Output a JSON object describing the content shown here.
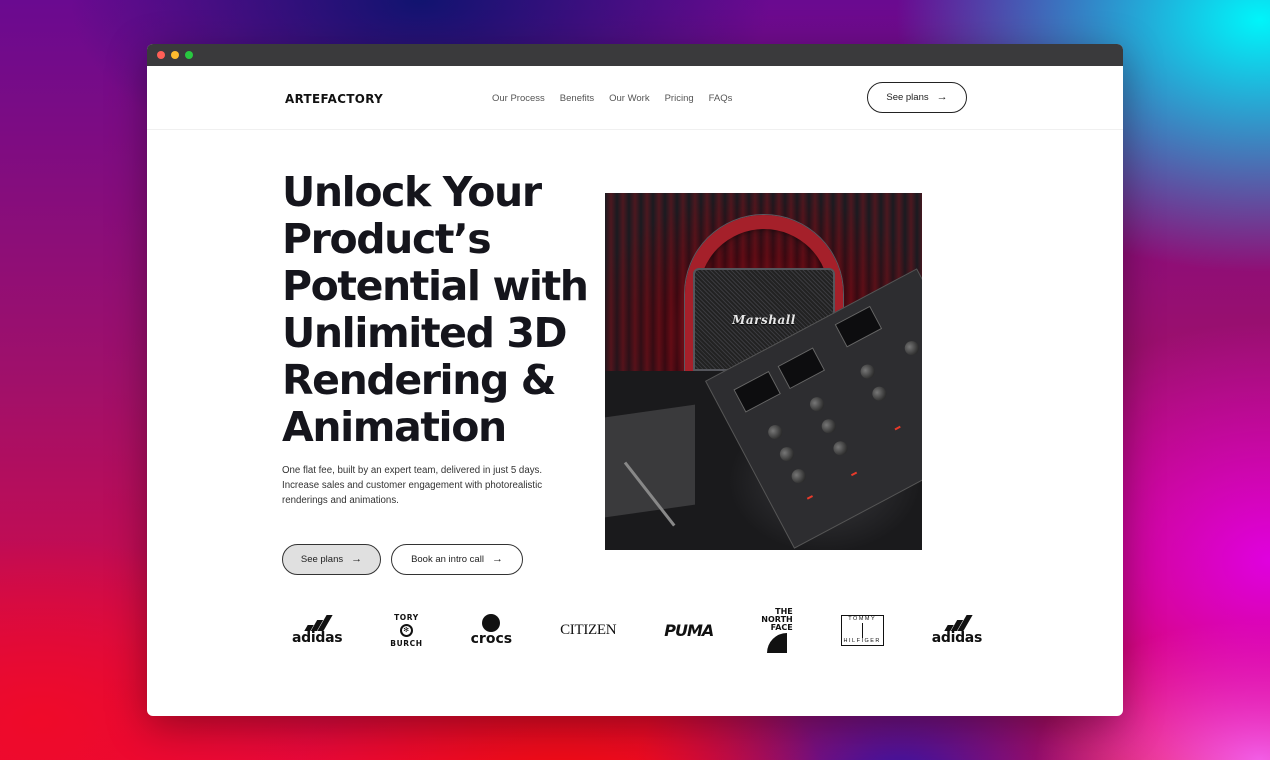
{
  "window": {
    "controls": [
      "close",
      "minimize",
      "maximize"
    ]
  },
  "nav": {
    "logo": "ARTEFACTORY",
    "links": [
      {
        "label": "Our Process"
      },
      {
        "label": "Benefits"
      },
      {
        "label": "Our Work"
      },
      {
        "label": "Pricing"
      },
      {
        "label": "FAQs"
      }
    ],
    "cta_label": "See plans",
    "cta_icon": "arrow-right-icon"
  },
  "hero": {
    "title": "Unlock Your Product’s Potential with Unlimited 3D Rendering & Animation",
    "subtitle": "One flat fee, built by an expert team, delivered in just 5 days. Increase sales and customer engagement with photorealistic renderings and animations.",
    "primary_button": "See plans",
    "secondary_button": "Book an intro call",
    "button_icon": "arrow-right-icon",
    "image": {
      "alt": "3D render of a Marshall speaker with headphones and an audio mixer",
      "speaker_brand": "Marshall"
    }
  },
  "logos": {
    "items": [
      {
        "name": "adidas",
        "text": "adidas"
      },
      {
        "name": "tory-burch",
        "text_left": "TORY",
        "text_right": "BURCH"
      },
      {
        "name": "crocs",
        "text": "crocs"
      },
      {
        "name": "citizen",
        "text": "CITIZEN"
      },
      {
        "name": "puma",
        "text": "PUMA"
      },
      {
        "name": "the-north-face",
        "line1": "THE",
        "line2": "NORTH",
        "line3": "FACE"
      },
      {
        "name": "tommy-hilfiger",
        "top": "TOMMY",
        "bottom": "HILFIGER"
      },
      {
        "name": "adidas",
        "text": "adidas"
      }
    ]
  },
  "colors": {
    "text_primary": "#15151c",
    "button_primary_bg": "#e0e0e0",
    "titlebar": "#3a3a3c"
  }
}
